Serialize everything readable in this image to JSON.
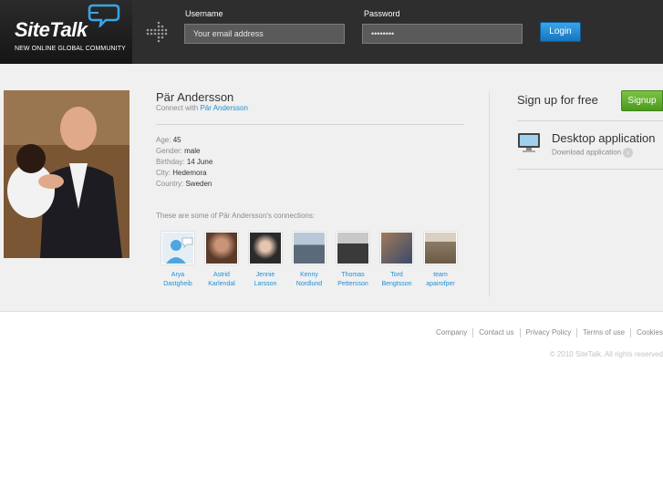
{
  "header": {
    "logo_text": "SiteTalk",
    "logo_tagline": "NEW ONLINE GLOBAL COMMUNITY",
    "username_label": "Username",
    "username_placeholder": "Your email address",
    "password_label": "Password",
    "password_value": "••••••••",
    "login_label": "Login"
  },
  "profile": {
    "name": "Pär Andersson",
    "connect_prefix": "Connect with ",
    "connect_link": "Pär Andersson",
    "age_label": "Age:",
    "age": "45",
    "gender_label": "Gender:",
    "gender": "male",
    "birthday_label": "Birthday:",
    "birthday": "14 June",
    "city_label": "City:",
    "city": "Hedemora",
    "country_label": "Country:",
    "country": "Sweden",
    "connections_title": "These are some of Pär Andersson's connections:"
  },
  "connections": [
    {
      "first": "Arya",
      "last": "Dastgheib",
      "color": "#e6eef5"
    },
    {
      "first": "Astrid",
      "last": "Karlendal",
      "color": "#5b3a2a"
    },
    {
      "first": "Jennie",
      "last": "Larsson",
      "color": "#2a2a2a"
    },
    {
      "first": "Kenny",
      "last": "Nordlund",
      "color": "#6f8aa6"
    },
    {
      "first": "Thomas",
      "last": "Pettersson",
      "color": "#5e5a55"
    },
    {
      "first": "Tord",
      "last": "Bengtsson",
      "color": "#7a5a40"
    },
    {
      "first": "team",
      "last": "apairofper",
      "color": "#8a7a66"
    }
  ],
  "sidebar": {
    "signup_text": "Sign up for free",
    "signup_label": "Signup",
    "desktop_title": "Desktop application",
    "desktop_sub": "Download application"
  },
  "footer": {
    "links": [
      "Company",
      "Contact us",
      "Privacy Policy",
      "Terms of use",
      "Cookies"
    ],
    "copyright": "© 2010 SiteTalk. All rights reserved"
  },
  "colors": {
    "accent_blue": "#1e90d6",
    "signup_green": "#5aa82a",
    "header_bg": "#2e2e2e"
  }
}
